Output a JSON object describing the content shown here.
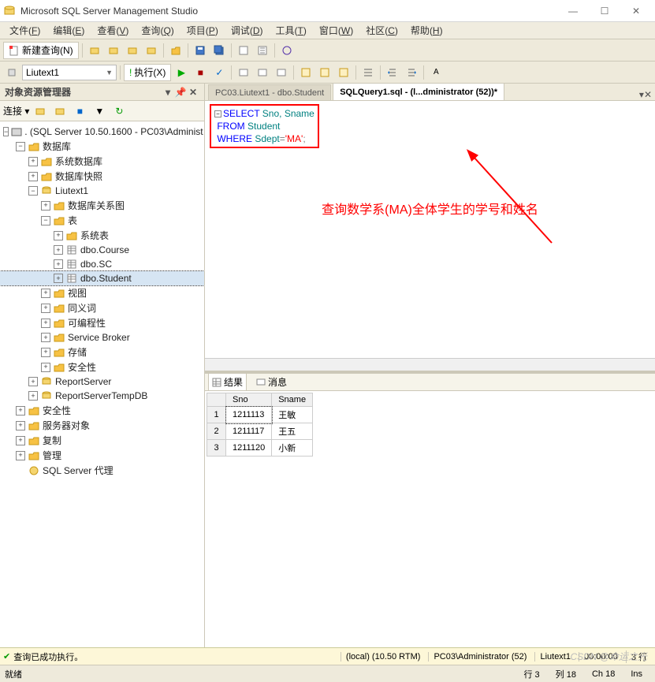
{
  "titlebar": {
    "title": "Microsoft SQL Server Management Studio"
  },
  "menubar": {
    "items": [
      {
        "label": "文件",
        "key": "F"
      },
      {
        "label": "编辑",
        "key": "E"
      },
      {
        "label": "查看",
        "key": "V"
      },
      {
        "label": "查询",
        "key": "Q"
      },
      {
        "label": "项目",
        "key": "P"
      },
      {
        "label": "调试",
        "key": "D"
      },
      {
        "label": "工具",
        "key": "T"
      },
      {
        "label": "窗口",
        "key": "W"
      },
      {
        "label": "社区",
        "key": "C"
      },
      {
        "label": "帮助",
        "key": "H"
      }
    ]
  },
  "toolbar": {
    "new_query": "新建查询(N)"
  },
  "toolbar2": {
    "db_combo": "Liutext1",
    "execute": "执行(X)"
  },
  "object_explorer": {
    "title": "对象资源管理器",
    "connect_label": "连接 ▾",
    "root": ". (SQL Server 10.50.1600 - PC03\\Administ",
    "nodes": {
      "databases": "数据库",
      "sys_db": "系统数据库",
      "db_snapshots": "数据库快照",
      "liutext1": "Liutext1",
      "db_diagrams": "数据库关系图",
      "tables": "表",
      "sys_tables": "系统表",
      "dbo_course": "dbo.Course",
      "dbo_sc": "dbo.SC",
      "dbo_student": "dbo.Student",
      "views": "视图",
      "synonyms": "同义词",
      "programmability": "可编程性",
      "service_broker": "Service Broker",
      "storage": "存储",
      "security_db": "安全性",
      "report_server": "ReportServer",
      "report_server_tmp": "ReportServerTempDB",
      "security": "安全性",
      "server_objects": "服务器对象",
      "replication": "复制",
      "management": "管理",
      "sql_agent": "SQL Server 代理"
    }
  },
  "editor": {
    "tabs": [
      {
        "label": "PC03.Liutext1 - dbo.Student",
        "active": false
      },
      {
        "label": "SQLQuery1.sql - (l...dministrator (52))*",
        "active": true
      }
    ],
    "sql": {
      "line1_kw": "SELECT",
      "line1_rest": " Sno, Sname",
      "line2_kw": "FROM",
      "line2_ident": " Student",
      "line3_kw": "WHERE",
      "line3_ident": " Sdept",
      "line3_op_eq": "=",
      "line3_str": "'MA'",
      "line3_semi": ";"
    },
    "annotation": "查询数学系(MA)全体学生的学号和姓名"
  },
  "results": {
    "tab_results": "结果",
    "tab_messages": "消息",
    "columns": [
      "Sno",
      "Sname"
    ],
    "rows": [
      [
        "1211113",
        "王敏"
      ],
      [
        "1211117",
        "王五"
      ],
      [
        "1211120",
        "小新"
      ]
    ]
  },
  "status_green": {
    "ok": "查询已成功执行。",
    "server": "(local) (10.50 RTM)",
    "user": "PC03\\Administrator (52)",
    "db": "Liutext1",
    "time": "00:00:00",
    "rows": "3 行"
  },
  "status_bot": {
    "ready": "就绪",
    "line": "行 3",
    "col": "列 18",
    "ch": "Ch 18",
    "ins": "Ins"
  },
  "watermark": "CSDN @命运之光"
}
